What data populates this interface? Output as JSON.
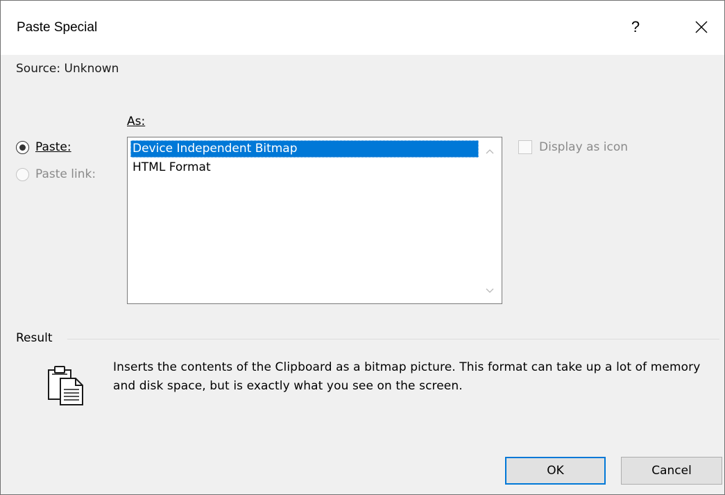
{
  "window": {
    "title": "Paste Special",
    "help_label": "?",
    "close_icon": "close-icon"
  },
  "source": {
    "text": "Source:  Unknown"
  },
  "options": {
    "as_label": "As:",
    "paste_label": "Paste:",
    "paste_link_label": "Paste link:",
    "selected_option": "Paste"
  },
  "formats": {
    "items": [
      {
        "label": "Device Independent Bitmap",
        "selected": true
      },
      {
        "label": "HTML Format",
        "selected": false
      }
    ]
  },
  "display_as_icon": {
    "label": "Display as icon",
    "checked": false
  },
  "result": {
    "heading": "Result",
    "icon": "clipboard-paste-icon",
    "description": "Inserts the contents of the Clipboard as a bitmap picture. This format can take up a lot of memory and disk space, but is exactly what you see on the screen."
  },
  "buttons": {
    "ok_label": "OK",
    "cancel_label": "Cancel"
  },
  "colors": {
    "selection": "#0078d7",
    "dialog_bg": "#f0f0f0",
    "default_button_border": "#0078d7"
  }
}
